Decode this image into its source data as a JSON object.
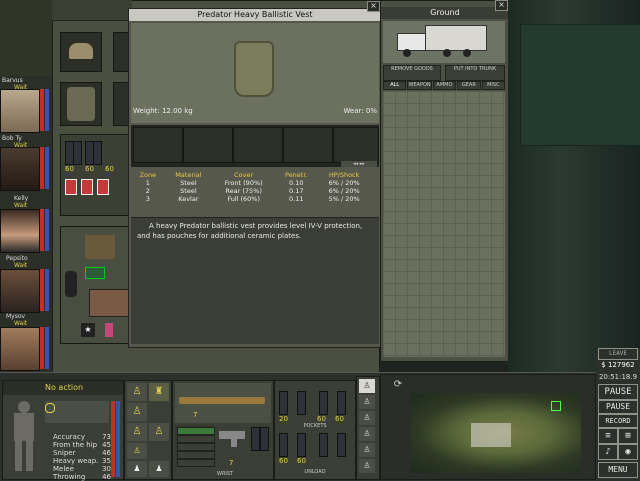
{
  "item_popup": {
    "title": "Predator Heavy Ballistic Vest",
    "weight": "Weight: 12.00 kg",
    "wear": "Wear: 0%",
    "table_headers": [
      "Zone",
      "Material",
      "Cover",
      "Penetr.",
      "HP/Shock"
    ],
    "table_rows": [
      [
        "1",
        "Steel",
        "Front (90%)",
        "0.10",
        "6% / 20%"
      ],
      [
        "2",
        "Steel",
        "Rear (75%)",
        "0.17",
        "6% / 20%"
      ],
      [
        "3",
        "Kevlar",
        "Full (60%)",
        "0.11",
        "5% / 20%"
      ]
    ],
    "description": "A heavy Predator ballistic vest provides level IV-V protection, and has pouches for additional ceramic plates."
  },
  "ground_panel": {
    "title": "Ground",
    "remove_goods": "REMOVE GOODS",
    "put_into_trunk": "PUT INTO TRUNK",
    "filters": [
      "ALL",
      "WEAPON",
      "AMMO",
      "GEAR",
      "MISC"
    ]
  },
  "mercs": [
    {
      "name": "Barvus",
      "status": "Wait"
    },
    {
      "name": "Bob Ty",
      "status": "Wait"
    },
    {
      "name": "Kelly",
      "status": "Wait"
    },
    {
      "name": "Pepsito",
      "status": "Wait"
    },
    {
      "name": "Mysov",
      "status": "Wait"
    }
  ],
  "action": {
    "label": "No action"
  },
  "stats": [
    {
      "label": "Accuracy",
      "value": "73"
    },
    {
      "label": "From the hip",
      "value": "45"
    },
    {
      "label": "Sniper",
      "value": "46"
    },
    {
      "label": "Heavy weap.",
      "value": "35"
    },
    {
      "label": "Melee",
      "value": "30"
    },
    {
      "label": "Throwing",
      "value": "46"
    }
  ],
  "hands": {
    "primary_ammo": "7",
    "secondary_ammo": "7",
    "wrist_label": "WRIST",
    "unload_label": "UNLOAD",
    "pockets_label": "POCKETS"
  },
  "pocket_counts": [
    "20",
    "60",
    "60",
    "60",
    "60"
  ],
  "inventory_counts": [
    "60",
    "60",
    "60"
  ],
  "status": {
    "money": "$ 127962",
    "time": "20:51:18.9",
    "top_label": "LEAVE",
    "pause1": "PAUSE",
    "pause2": "PAUSE",
    "record": "RECORD",
    "menu": "MENU"
  },
  "colors": {
    "accent": "#e3d24d",
    "panel": "#3f4438",
    "grid": "#6a6f5e"
  }
}
